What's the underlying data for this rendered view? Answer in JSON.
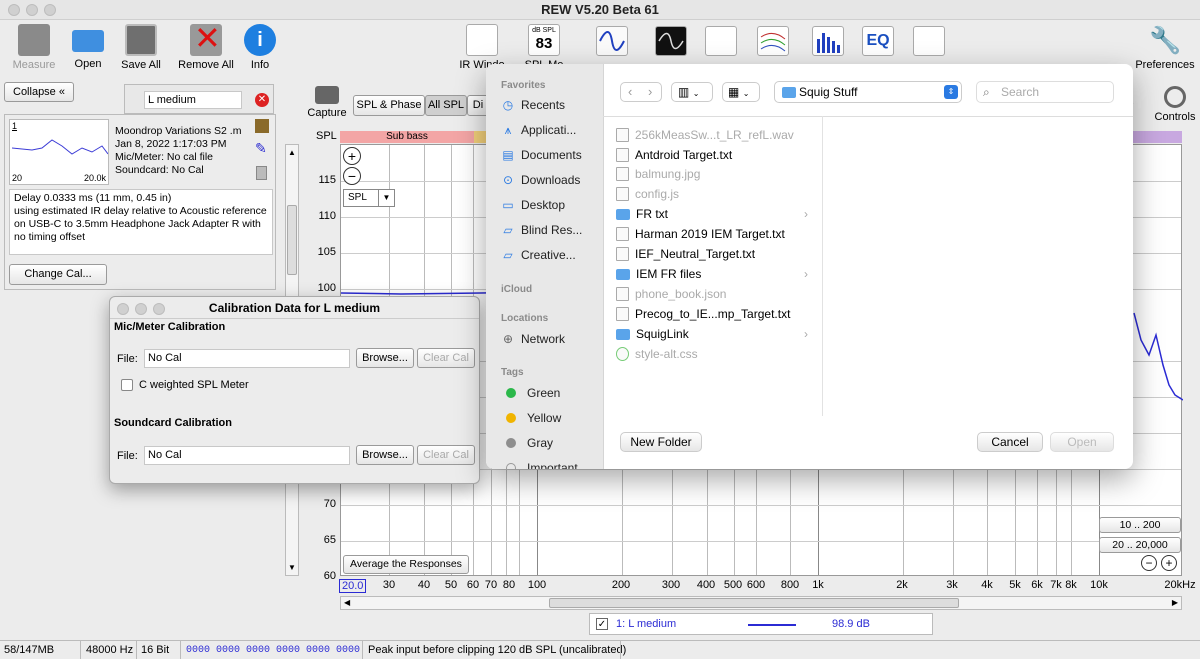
{
  "window": {
    "title": "REW V5.20 Beta 61"
  },
  "toolbar": {
    "measure": "Measure",
    "open": "Open",
    "save_all": "Save All",
    "remove_all": "Remove All",
    "info": "Info",
    "ir_windows": "IR Windo",
    "spl_meter_value": "83",
    "spl_meter_top": "dB SPL",
    "spl_meter": "SPL Me",
    "preferences": "Preferences",
    "controls": "Controls"
  },
  "left": {
    "collapse": "Collapse",
    "meas_name": "L medium",
    "details": [
      "Moondrop Variations S2 .m",
      "Jan 8, 2022 1:17:03 PM",
      "Mic/Meter: No cal file",
      "Soundcard: No Cal"
    ],
    "thumb_xmin": "20",
    "thumb_xmax": "20.0k",
    "thumb_index": "1",
    "notes": "Delay 0.0333 ms (11 mm, 0.45 in)\nusing estimated IR delay relative to Acoustic reference on USB-C to 3.5mm Headphone Jack Adapter R with no timing offset",
    "change_cal": "Change Cal..."
  },
  "graph": {
    "capture": "Capture",
    "tabs": [
      "SPL & Phase",
      "All SPL",
      "Di"
    ],
    "ylabel": "SPL",
    "band_label": "Sub bass",
    "spl_select": "SPL",
    "yticks": [
      "115",
      "110",
      "105",
      "100",
      "70",
      "65",
      "60"
    ],
    "xticks": [
      "20.0",
      "30",
      "40",
      "50",
      "60",
      "70",
      "80",
      "100",
      "200",
      "300",
      "400",
      "500",
      "600",
      "800",
      "1k",
      "2k",
      "3k",
      "4k",
      "5k",
      "6k",
      "7k",
      "8k",
      "10k",
      "20kHz"
    ],
    "average": "Average the Responses",
    "range1": "10 .. 200",
    "range2": "20 .. 20,000",
    "legend": {
      "name": "1: L medium",
      "value": "98.9 dB",
      "color": "#2b2bd4"
    }
  },
  "cal_dialog": {
    "title": "Calibration Data for L medium",
    "mic_section": "Mic/Meter Calibration",
    "file_label": "File:",
    "mic_file": "No Cal",
    "browse": "Browse...",
    "clear": "Clear Cal",
    "c_weighted": "C weighted SPL Meter",
    "sc_section": "Soundcard Calibration",
    "sc_file": "No Cal"
  },
  "file_dialog": {
    "favorites": "Favorites",
    "fav_items": [
      "Recents",
      "Applicati...",
      "Documents",
      "Downloads",
      "Desktop",
      "Blind Res...",
      "Creative..."
    ],
    "icloud": "iCloud",
    "locations": "Locations",
    "network": "Network",
    "tags": "Tags",
    "tag_items": [
      {
        "name": "Green",
        "color": "#2bb84a"
      },
      {
        "name": "Yellow",
        "color": "#f0b400"
      },
      {
        "name": "Gray",
        "color": "#8e8e8e"
      },
      {
        "name": "Important",
        "color": "#ffffff"
      }
    ],
    "folder": "Squig Stuff",
    "search_placeholder": "Search",
    "files": [
      {
        "name": "256kMeasSw...t_LR_refL.wav",
        "type": "file",
        "dim": true
      },
      {
        "name": "Antdroid Target.txt",
        "type": "file",
        "dim": false
      },
      {
        "name": "balmung.jpg",
        "type": "file",
        "dim": true
      },
      {
        "name": "config.js",
        "type": "file",
        "dim": true
      },
      {
        "name": "FR txt",
        "type": "folder",
        "dim": false
      },
      {
        "name": "Harman 2019 IEM Target.txt",
        "type": "file",
        "dim": false
      },
      {
        "name": "IEF_Neutral_Target.txt",
        "type": "file",
        "dim": false
      },
      {
        "name": "IEM FR files",
        "type": "folder",
        "dim": false
      },
      {
        "name": "phone_book.json",
        "type": "file",
        "dim": true
      },
      {
        "name": "Precog_to_IE...mp_Target.txt",
        "type": "file",
        "dim": false
      },
      {
        "name": "SquigLink",
        "type": "folder",
        "dim": false
      },
      {
        "name": "style-alt.css",
        "type": "file",
        "dim": true
      }
    ],
    "new_folder": "New Folder",
    "cancel": "Cancel",
    "open": "Open"
  },
  "status": {
    "memory": "58/147MB",
    "rate": "48000 Hz",
    "bits": "16 Bit",
    "hex": "0000 0000  0000 0000  0000 0000",
    "peak": "Peak input before clipping 120 dB SPL (uncalibrated)"
  }
}
